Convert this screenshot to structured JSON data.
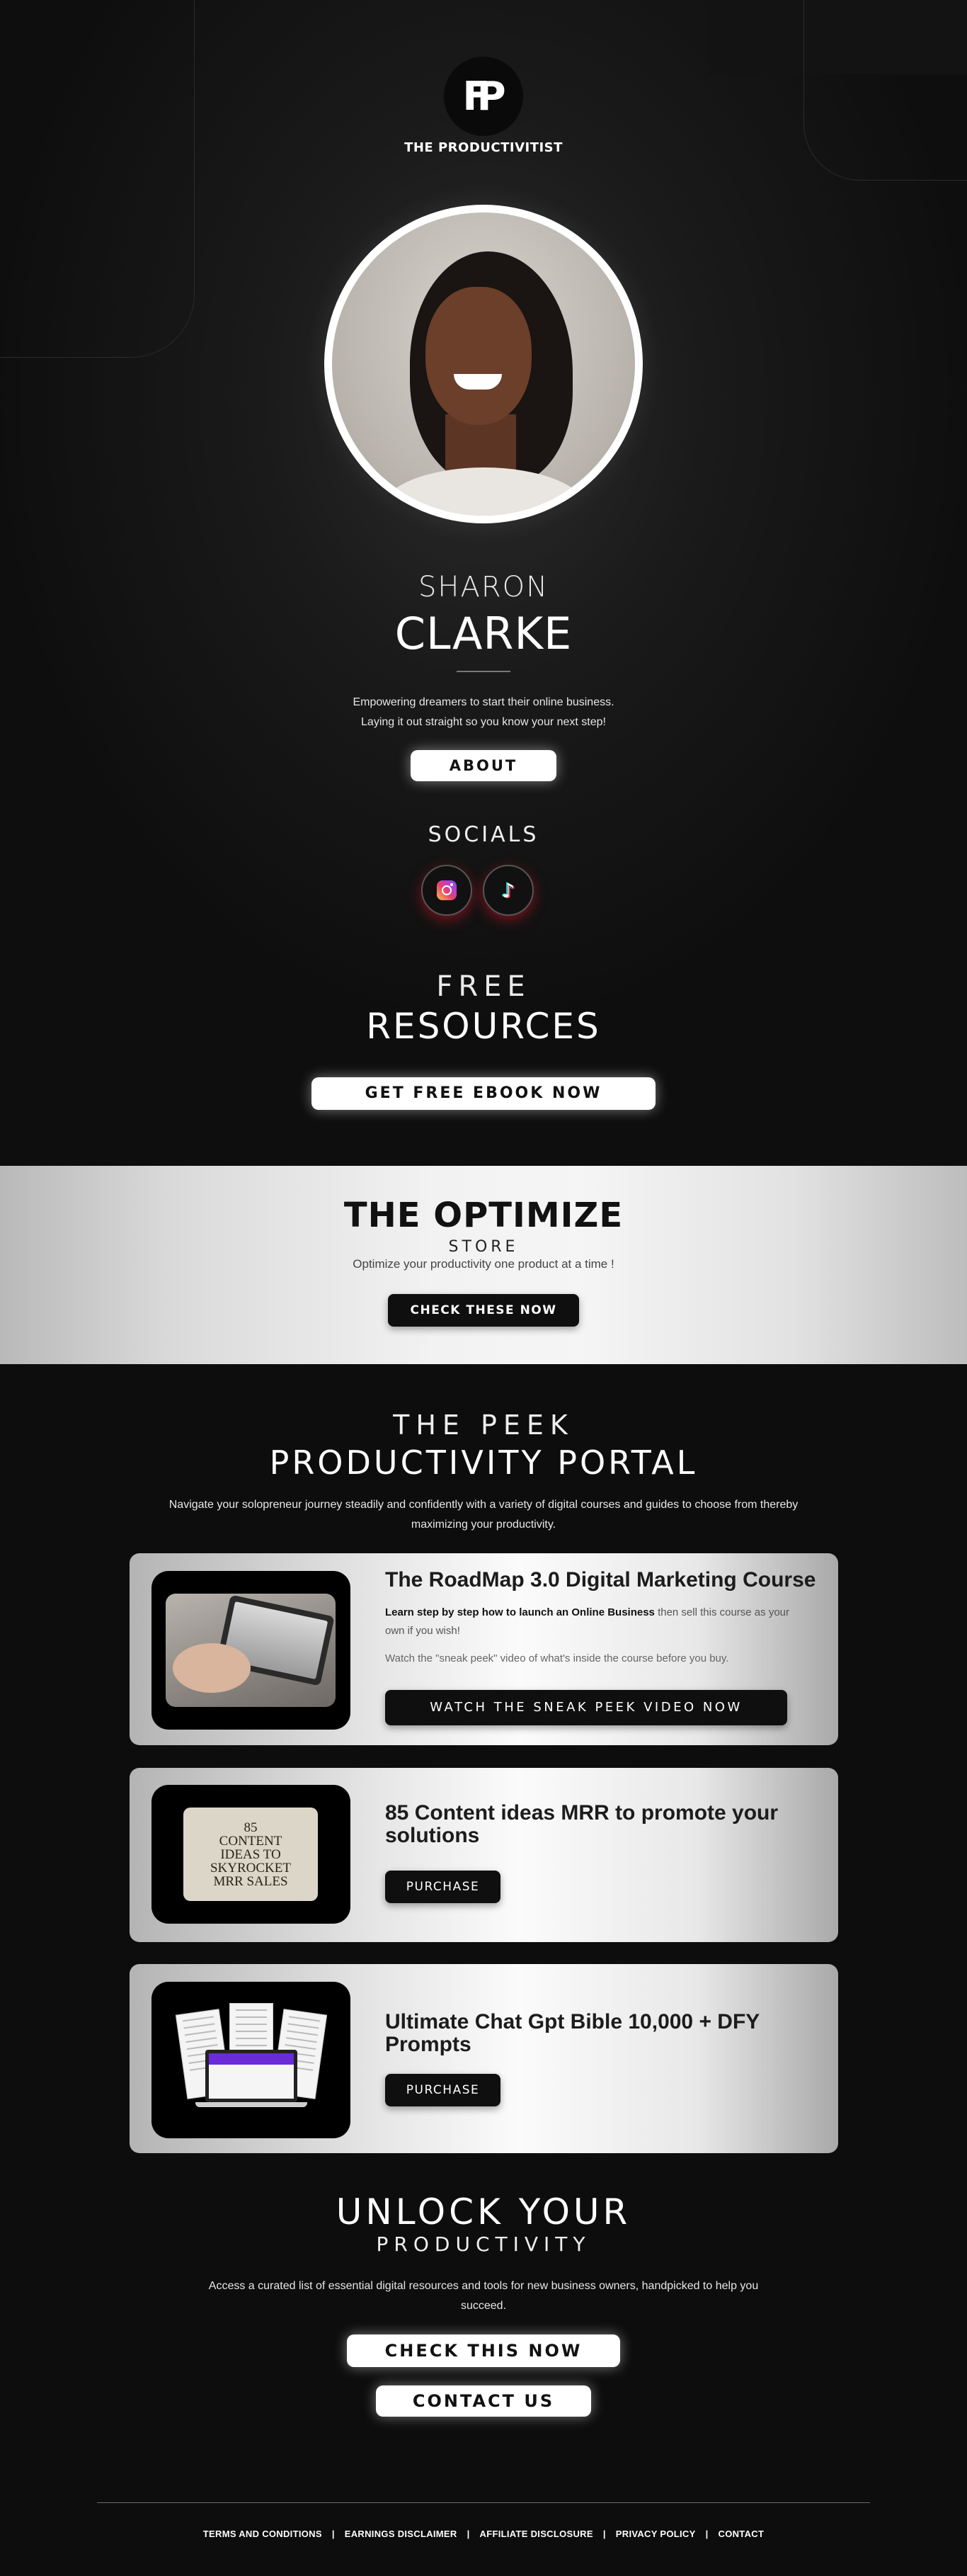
{
  "brand": {
    "logo_mark": "FP",
    "name": "THE PRODUCTIVITIST"
  },
  "profile": {
    "first_name": "SHARON",
    "last_name": "CLARKE",
    "tagline_line1": "Empowering dreamers to start their online business.",
    "tagline_line2": "Laying it out straight so you know your next step!",
    "about_label": "ABOUT"
  },
  "socials": {
    "title": "SOCIALS",
    "items": [
      {
        "name": "instagram",
        "icon": "instagram-icon"
      },
      {
        "name": "tiktok",
        "icon": "tiktok-icon",
        "glyph": "♪"
      }
    ]
  },
  "free_resources": {
    "title_line1": "FREE",
    "title_line2": "RESOURCES",
    "button_label": "GET FREE EBOOK NOW"
  },
  "store": {
    "title": "THE OPTIMIZE",
    "subtitle": "STORE",
    "description": "Optimize your productivity one product at a time !",
    "button_label": "CHECK THESE NOW"
  },
  "portal": {
    "title_line1": "THE PEEK",
    "title_line2": "PRODUCTIVITY PORTAL",
    "description": "Navigate your solopreneur journey steadily and confidently with a variety of digital courses and guides to choose from thereby maximizing your productivity."
  },
  "products": [
    {
      "title": "The RoadMap 3.0 Digital Marketing Course",
      "body_bold": "Learn step by step how to launch an Online Business",
      "body_rest": " then sell this course as your own if you wish!",
      "body_2": "Watch the \"sneak peek\" video of what's inside the course before you buy.",
      "button_label": "WATCH THE SNEAK PEEK VIDEO NOW"
    },
    {
      "title": "85 Content ideas MRR to promote your solutions",
      "cover_lines": [
        "85",
        "CONTENT",
        "IDEAS TO",
        "SKYROCKET",
        "MRR SALES"
      ],
      "button_label": "PURCHASE"
    },
    {
      "title": "Ultimate Chat Gpt Bible 10,000 + DFY Prompts",
      "button_label": "PURCHASE"
    }
  ],
  "unlock": {
    "title_line1": "UNLOCK YOUR",
    "title_line2": "PRODUCTIVITY",
    "description": "Access a curated list of essential digital resources and tools for new business owners, handpicked to help you succeed.",
    "check_label": "CHECK THIS NOW",
    "contact_label": "CONTACT US"
  },
  "footer": {
    "links": [
      "TERMS AND CONDITIONS",
      "EARNINGS DISCLAIMER",
      "AFFILIATE DISCLOSURE",
      "PRIVACY POLICY",
      "CONTACT"
    ],
    "separator": "|"
  },
  "colors": {
    "background": "#0d0d0d",
    "button_light": "#ffffff",
    "button_dark": "#0f0f0f",
    "social_glow": "#c81428"
  }
}
